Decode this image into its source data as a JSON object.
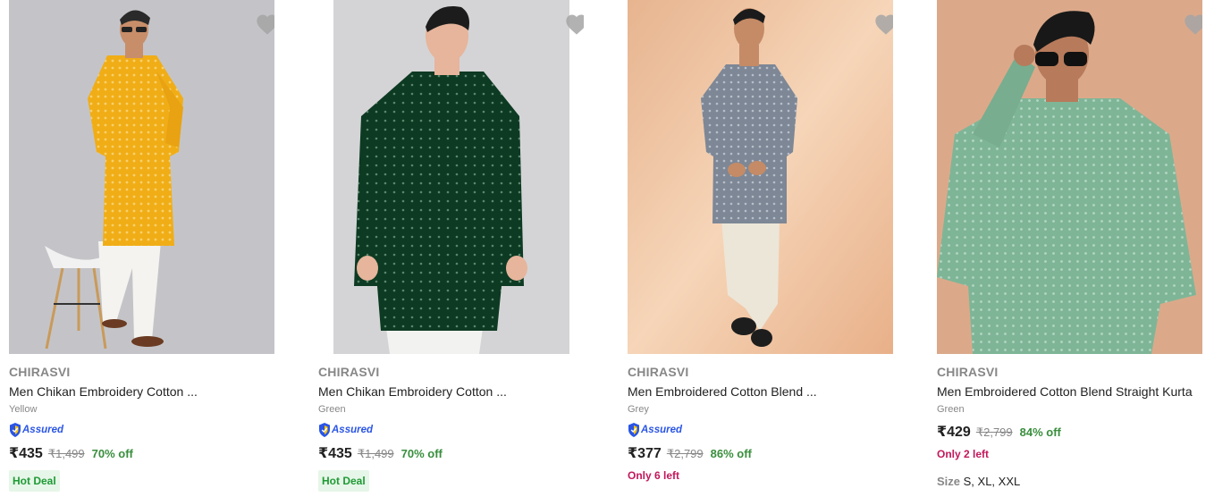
{
  "products": [
    {
      "brand": "CHIRASVI",
      "title": "Men Chikan Embroidery Cotton ...",
      "color": "Yellow",
      "assured": "Assured",
      "price": "₹435",
      "mrp": "₹1,499",
      "discount": "70% off",
      "badge": "Hot Deal",
      "image_icon": "yellow-kurta-model-photo"
    },
    {
      "brand": "CHIRASVI",
      "title": "Men Chikan Embroidery Cotton ...",
      "color": "Green",
      "assured": "Assured",
      "price": "₹435",
      "mrp": "₹1,499",
      "discount": "70% off",
      "badge": "Hot Deal",
      "image_icon": "green-kurta-model-photo"
    },
    {
      "brand": "CHIRASVI",
      "title": "Men Embroidered Cotton Blend ...",
      "color": "Grey",
      "assured": "Assured",
      "price": "₹377",
      "mrp": "₹2,799",
      "discount": "86% off",
      "stock": "Only 6 left",
      "image_icon": "grey-kurta-model-photo"
    },
    {
      "brand": "CHIRASVI",
      "title": "Men Embroidered Cotton Blend Straight Kurta",
      "color": "Green",
      "price": "₹429",
      "mrp": "₹2,799",
      "discount": "84% off",
      "stock": "Only 2 left",
      "size_label": "Size",
      "sizes": "S, XL, XXL",
      "image_icon": "mint-kurta-model-photo"
    }
  ],
  "colors": {
    "brand_text": "#878787",
    "discount": "#388e3c",
    "assured": "#2a55e5",
    "stock": "#c2185b",
    "deal_bg": "#e6f6e8",
    "wishlist_heart": "#c2c2c2"
  }
}
